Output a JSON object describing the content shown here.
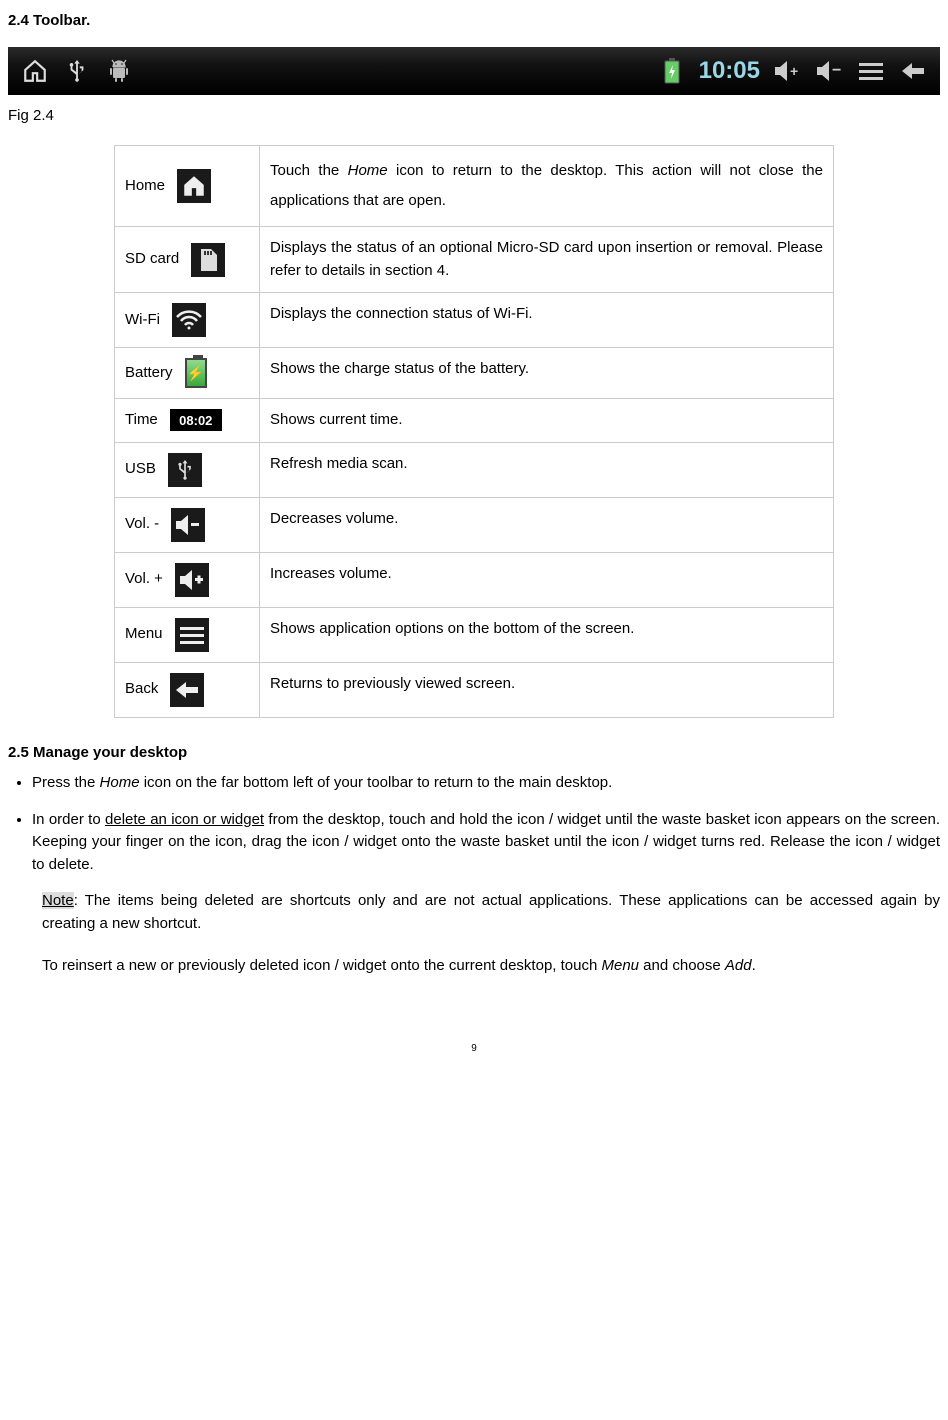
{
  "headings": {
    "section24": "2.4 Toolbar.",
    "fig24": "Fig 2.4",
    "section25": "2.5 Manage your desktop"
  },
  "toolbar_time": "10:05",
  "rows": [
    {
      "label": "Home",
      "desc_pre": "Touch the ",
      "desc_em": "Home",
      "desc_post": " icon to return to the desktop.  This action will not close the applications that are open."
    },
    {
      "label": "SD card",
      "desc": "Displays the status of an optional Micro-SD card upon insertion or removal. Please refer to details in section 4."
    },
    {
      "label": "Wi-Fi",
      "desc": "Displays the connection status of Wi-Fi."
    },
    {
      "label": "Battery",
      "desc": "Shows the charge status of the battery."
    },
    {
      "label": "Time",
      "desc": "Shows current time.",
      "time_value": "08:02"
    },
    {
      "label": "USB",
      "desc": "Refresh media scan."
    },
    {
      "label": "Vol. -",
      "desc": "Decreases volume."
    },
    {
      "label": "Vol. +",
      "desc": "Increases volume."
    },
    {
      "label": "Menu",
      "desc": "Shows application options on the bottom of the screen."
    },
    {
      "label": "Back",
      "desc": "Returns to previously viewed screen."
    }
  ],
  "bullets": {
    "b1_pre": "Press the ",
    "b1_em": "Home",
    "b1_post": " icon on the far bottom left of your toolbar to return to the main desktop.",
    "b2_pre": "In order to ",
    "b2_ul": "delete an icon or widget",
    "b2_post": " from the desktop, touch and hold the icon / widget until the waste basket icon appears on the screen.  Keeping your finger on the icon, drag the icon / widget onto the waste basket until the icon / widget turns red.  Release the icon / widget to delete."
  },
  "note": {
    "label": "Note",
    "text": ": The items being deleted are shortcuts only and are not actual applications. These applications can be accessed again by creating a new shortcut."
  },
  "reinsert": {
    "pre": "To reinsert a new or previously deleted icon / widget onto the current desktop, touch ",
    "em1": "Menu",
    "mid": " and choose ",
    "em2": "Add",
    "post": "."
  },
  "page_number": "9"
}
